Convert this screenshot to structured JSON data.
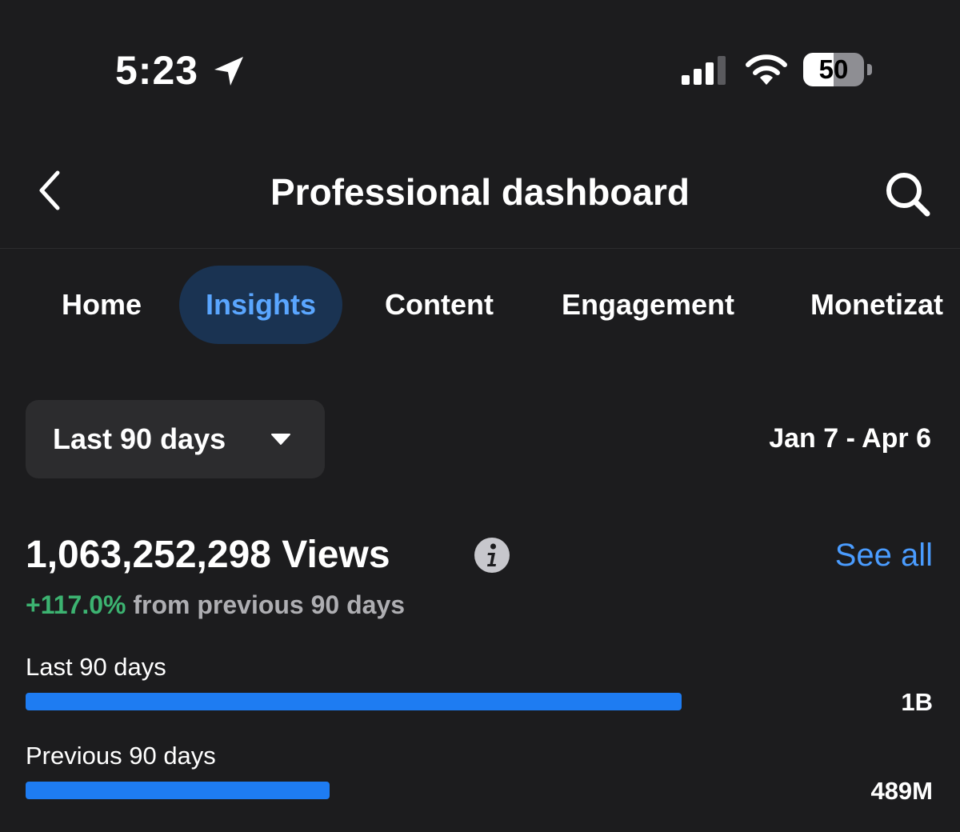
{
  "status_bar": {
    "time": "5:23",
    "battery": "50",
    "battery_level": 0.5,
    "icons": [
      "location-arrow-icon",
      "cellular-signal-icon",
      "wifi-icon",
      "battery-icon"
    ]
  },
  "header": {
    "title": "Professional dashboard",
    "back_icon": "chevron-left-icon",
    "search_icon": "search-icon"
  },
  "tabs": [
    {
      "label": "Home",
      "active": false
    },
    {
      "label": "Insights",
      "active": true
    },
    {
      "label": "Content",
      "active": false
    },
    {
      "label": "Engagement",
      "active": false
    },
    {
      "label": "Monetizat",
      "active": false
    }
  ],
  "filter": {
    "range_label": "Last 90 days",
    "date_range": "Jan 7 - Apr 6"
  },
  "views": {
    "total": "1,063,252,298 Views",
    "change_pct": "+117.0%",
    "change_suffix": " from previous 90 days",
    "see_all": "See all"
  },
  "comparison": [
    {
      "label": "Last 90 days",
      "value": "1B",
      "fraction": 0.82
    },
    {
      "label": "Previous 90 days",
      "value": "489M",
      "fraction": 0.38
    }
  ],
  "colors": {
    "background": "#1c1c1e",
    "accent_blue": "#1e7cf2",
    "link_blue": "#4a9cff",
    "positive_green": "#3cb371",
    "active_tab_bg": "#1a3352"
  }
}
